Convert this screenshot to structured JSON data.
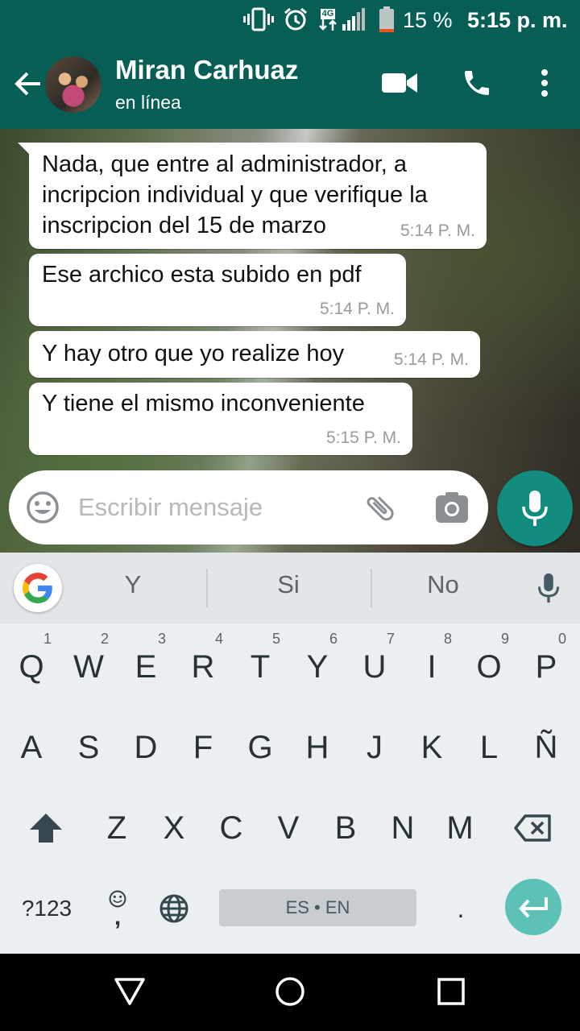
{
  "status_bar": {
    "network_badge": "4G",
    "battery_percent": "15 %",
    "battery_level": 0.15,
    "time": "5:15 p. m.",
    "icons": [
      "vibrate-icon",
      "alarm-icon",
      "signal-icon",
      "battery-icon"
    ]
  },
  "header": {
    "contact_name": "Miran Carhuaz",
    "contact_status": "en línea",
    "actions": [
      "back-arrow-icon",
      "video-call-icon",
      "phone-icon",
      "more-vert-icon"
    ]
  },
  "messages": [
    {
      "text": "Nada, que entre al administrador, a\nincripcion individual y que verifique la\ninscripcion del 15 de marzo",
      "time": "5:14 P. M."
    },
    {
      "text": "Ese archico esta subido en pdf",
      "time": "5:14 P. M."
    },
    {
      "text": "Y hay otro que yo realize hoy",
      "time": "5:14 P. M."
    },
    {
      "text": "Y tiene el mismo inconveniente",
      "time": "5:15 P. M."
    }
  ],
  "composer": {
    "placeholder": "Escribir mensaje",
    "icons": [
      "emoji-icon",
      "attach-icon",
      "camera-icon",
      "mic-icon"
    ]
  },
  "keyboard": {
    "suggestions": [
      "Y",
      "Si",
      "No"
    ],
    "row1": [
      {
        "label": "Q",
        "hint": "1"
      },
      {
        "label": "W",
        "hint": "2"
      },
      {
        "label": "E",
        "hint": "3"
      },
      {
        "label": "R",
        "hint": "4"
      },
      {
        "label": "T",
        "hint": "5"
      },
      {
        "label": "Y",
        "hint": "6"
      },
      {
        "label": "U",
        "hint": "7"
      },
      {
        "label": "I",
        "hint": "8"
      },
      {
        "label": "O",
        "hint": "9"
      },
      {
        "label": "P",
        "hint": "0"
      }
    ],
    "row2": [
      "A",
      "S",
      "D",
      "F",
      "G",
      "H",
      "J",
      "K",
      "L",
      "Ñ"
    ],
    "row3": [
      "Z",
      "X",
      "C",
      "V",
      "B",
      "N",
      "M"
    ],
    "symbols_label": "?123",
    "emoji_comma": ",",
    "space_label": "ES • EN",
    "period_label": "."
  },
  "colors": {
    "header": "#075E54",
    "accent": "#128C7E",
    "enter_key": "#5DC1B6",
    "keyboard_bg": "#ECEFF1"
  }
}
